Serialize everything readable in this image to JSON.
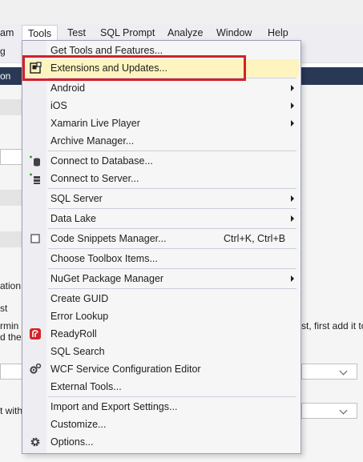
{
  "menubar": {
    "items": [
      {
        "label": "am"
      },
      {
        "label": "Tools"
      },
      {
        "label": "Test"
      },
      {
        "label": "SQL Prompt"
      },
      {
        "label": "Analyze"
      },
      {
        "label": "Window"
      },
      {
        "label": "Help"
      }
    ]
  },
  "toolbar": {
    "fragment": "g"
  },
  "background": {
    "navy_label": "on",
    "fragments": {
      "a1": "ation",
      "a2": "st",
      "a3": "rmin",
      "a4": "d the",
      "b1": "st, first add it to",
      "b2": "t with"
    }
  },
  "menu": {
    "items": [
      {
        "label": "Get Tools and Features...",
        "icon": "none"
      },
      {
        "label": "Extensions and Updates...",
        "icon": "extensions-icon"
      },
      {
        "label": "Android",
        "submenu": true
      },
      {
        "label": "iOS",
        "submenu": true
      },
      {
        "label": "Xamarin Live Player",
        "submenu": true
      },
      {
        "label": "Archive Manager..."
      },
      {
        "label": "Connect to Database...",
        "icon": "connect-database-icon"
      },
      {
        "label": "Connect to Server...",
        "icon": "connect-server-icon"
      },
      {
        "label": "SQL Server",
        "submenu": true
      },
      {
        "label": "Data Lake",
        "submenu": true
      },
      {
        "label": "Code Snippets Manager...",
        "shortcut": "Ctrl+K, Ctrl+B",
        "icon": "code-snippets-icon"
      },
      {
        "label": "Choose Toolbox Items..."
      },
      {
        "label": "NuGet Package Manager",
        "submenu": true
      },
      {
        "label": "Create GUID"
      },
      {
        "label": "Error Lookup"
      },
      {
        "label": "ReadyRoll",
        "icon": "readyroll-icon"
      },
      {
        "label": "SQL Search"
      },
      {
        "label": "WCF Service Configuration Editor",
        "icon": "wcf-config-icon"
      },
      {
        "label": "External Tools..."
      },
      {
        "label": "Import and Export Settings..."
      },
      {
        "label": "Customize..."
      },
      {
        "label": "Options...",
        "icon": "gear-icon"
      }
    ]
  },
  "colors": {
    "highlight": "#fdf4bf",
    "callout_border": "#d42027",
    "navy": "#293955"
  }
}
